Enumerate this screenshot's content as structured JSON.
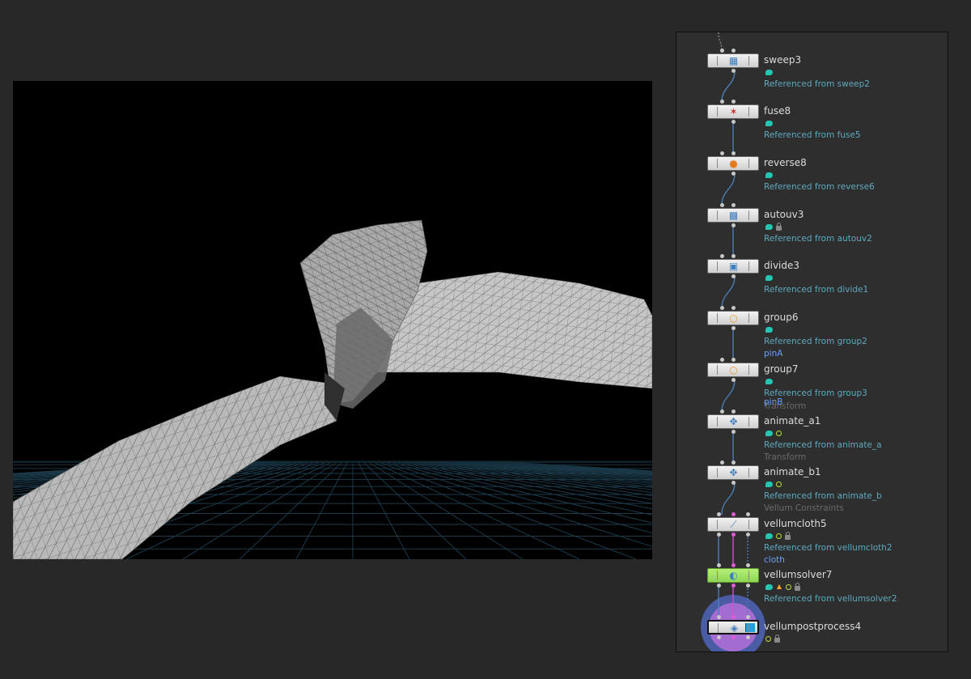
{
  "viewport": {
    "background": "#000000",
    "mesh_color": "#bdbdbd",
    "grid_color": "#1b3a4a"
  },
  "network": {
    "nodes": [
      {
        "name": "sweep3",
        "icon": "sweep-icon",
        "glyph": "▦",
        "ref": "Referenced from sweep2",
        "badges": [
          "comment"
        ]
      },
      {
        "name": "fuse8",
        "icon": "fuse-icon",
        "glyph": "✶",
        "ref": "Referenced from fuse5",
        "badges": [
          "comment"
        ]
      },
      {
        "name": "reverse8",
        "icon": "reverse-icon",
        "glyph": "●",
        "ref": "Referenced from reverse6",
        "badges": [
          "comment"
        ]
      },
      {
        "name": "autouv3",
        "icon": "checker-icon",
        "glyph": "▩",
        "ref": "Referenced from autouv2",
        "badges": [
          "comment",
          "lock"
        ]
      },
      {
        "name": "divide3",
        "icon": "divide-icon",
        "glyph": "▣",
        "ref": "Referenced from divide1",
        "badges": [
          "comment"
        ]
      },
      {
        "name": "group6",
        "icon": "group-icon",
        "glyph": "○",
        "ref": "Referenced from group2",
        "badges": [
          "comment"
        ]
      },
      {
        "name": "group7",
        "icon": "group-icon",
        "glyph": "○",
        "ref": "Referenced from group3",
        "badges": [
          "comment"
        ]
      },
      {
        "name": "animate_a1",
        "icon": "transform-icon",
        "glyph": "✥",
        "ref": "Referenced from animate_a",
        "badges": [
          "comment",
          "spare"
        ]
      },
      {
        "name": "animate_b1",
        "icon": "transform-icon",
        "glyph": "✥",
        "ref": "Referenced from animate_b",
        "badges": [
          "comment",
          "spare"
        ]
      },
      {
        "name": "vellumcloth5",
        "icon": "vellum-cloth-icon",
        "glyph": "⟋",
        "ref": "Referenced from vellumcloth2",
        "badges": [
          "comment",
          "spare",
          "lock"
        ]
      },
      {
        "name": "vellumsolver7",
        "icon": "vellum-solver-icon",
        "glyph": "◐",
        "ref": "Referenced from vellumsolver2",
        "badges": [
          "comment",
          "fire",
          "spare",
          "lock"
        ]
      },
      {
        "name": "vellumpostprocess4",
        "icon": "vellum-post-icon",
        "glyph": "◈",
        "ref": "",
        "badges": [
          "spare",
          "lock"
        ]
      }
    ],
    "tags": {
      "pinA": "pinA",
      "pinB": "pinB",
      "transform_a": "Transform",
      "transform_b": "Transform",
      "vellum_constraints": "Vellum Constraints",
      "cloth": "cloth"
    },
    "colors": {
      "wire": "#4a7fb8",
      "constraint_wire": "#d14fcf",
      "reference_text": "#5fa9bf",
      "comment_badge": "#22c7b2",
      "solver_node": "#9fe066",
      "display_ring": "#4d64b8",
      "render_ring": "#b36fd8"
    }
  }
}
